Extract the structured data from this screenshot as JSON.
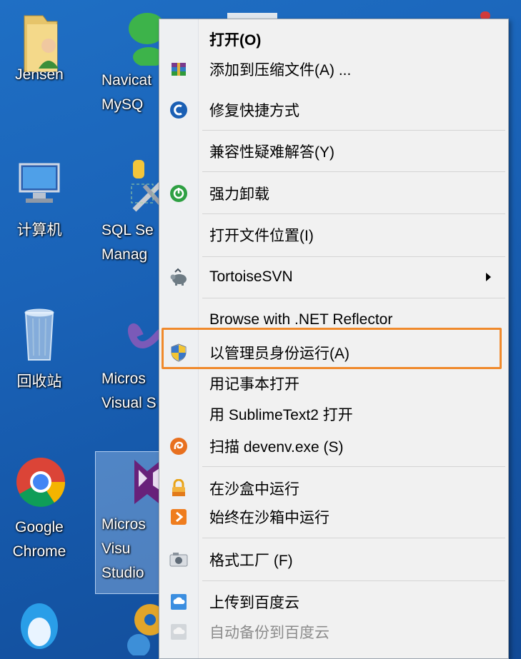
{
  "desktop": {
    "icons": [
      {
        "label": "Jensen"
      },
      {
        "label": "Navicat\nMySQ"
      },
      {
        "label": "计算机"
      },
      {
        "label": "SQL Se\nManag"
      },
      {
        "label": "回收站"
      },
      {
        "label": "Micros\nVisual S"
      },
      {
        "label": "Google\nChrome"
      },
      {
        "label": "Micros\nVisu\nStudio"
      }
    ]
  },
  "menu": {
    "items": [
      {
        "label": "打开(O)",
        "icon": "none"
      },
      {
        "label": "添加到压缩文件(A) ...",
        "icon": "winrar-icon"
      },
      {
        "label": "修复快捷方式",
        "icon": "repair-icon"
      },
      {
        "label": "兼容性疑难解答(Y)",
        "icon": "none"
      },
      {
        "label": "强力卸载",
        "icon": "uninstall-icon"
      },
      {
        "label": "打开文件位置(I)",
        "icon": "none"
      },
      {
        "label": "TortoiseSVN",
        "icon": "tortoisesvn-icon"
      },
      {
        "label": "Browse with .NET Reflector",
        "icon": "none"
      },
      {
        "label": "以管理员身份运行(A)",
        "icon": "uac-shield-icon"
      },
      {
        "label": "用记事本打开",
        "icon": "none"
      },
      {
        "label": "用 SublimeText2 打开",
        "icon": "none"
      },
      {
        "label": "扫描 devenv.exe (S)",
        "icon": "antivirus-icon"
      },
      {
        "label": "在沙盒中运行",
        "icon": "sandbox-lock-icon"
      },
      {
        "label": "始终在沙箱中运行",
        "icon": "sandbox-run-icon"
      },
      {
        "label": "格式工厂 (F)",
        "icon": "format-factory-icon"
      },
      {
        "label": "上传到百度云",
        "icon": "baidu-upload-icon"
      },
      {
        "label": "自动备份到百度云",
        "icon": "baidu-backup-icon"
      }
    ]
  },
  "colors": {
    "highlight": "#f08a2c",
    "desktop": "#1a63b8"
  }
}
